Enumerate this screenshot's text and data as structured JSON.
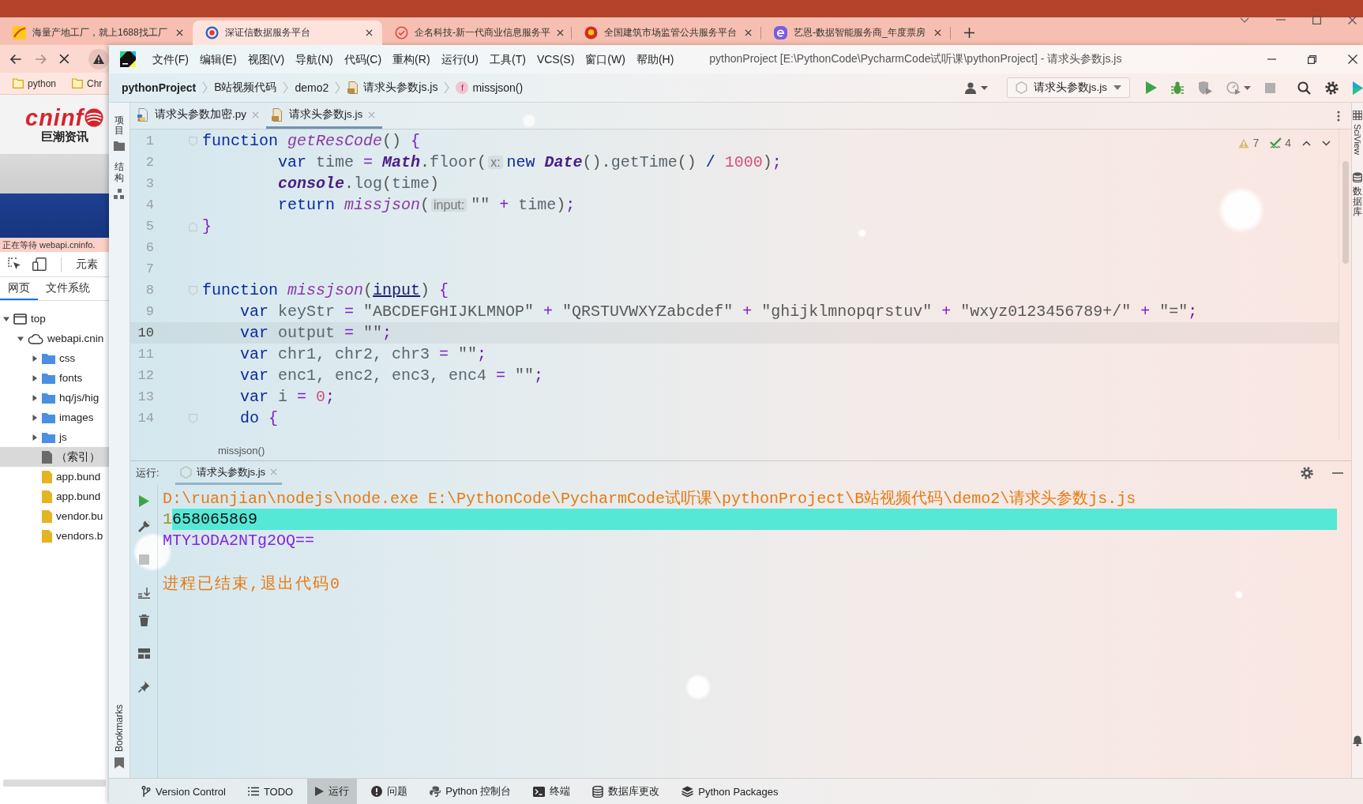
{
  "browser": {
    "tabs": [
      {
        "title": "海量产地工厂，就上1688找工厂",
        "selected": false
      },
      {
        "title": "深证信数据服务平台",
        "selected": true
      },
      {
        "title": "企名科技-新一代商业信息服务平",
        "selected": false
      },
      {
        "title": "全国建筑市场监管公共服务平台",
        "selected": false
      },
      {
        "title": "艺恩-数据智能服务商_年度票房",
        "selected": false
      }
    ],
    "bookmarks": [
      {
        "label": "python"
      },
      {
        "label": "Chr"
      }
    ],
    "page": {
      "logo": "cninf",
      "logo_subtitle": "巨潮资讯",
      "status": "正在等待 webapi.cninfo."
    },
    "devtools": {
      "panel": "元素",
      "tabs": [
        {
          "label": "网页",
          "selected": true
        },
        {
          "label": "文件系统",
          "selected": false
        }
      ],
      "tree": [
        {
          "label": "top",
          "kind": "frame",
          "expanded": true,
          "selected": false,
          "children": [
            {
              "label": "webapi.cnin",
              "kind": "origin",
              "expanded": true,
              "selected": false,
              "children": [
                {
                  "label": "css",
                  "kind": "folder",
                  "expanded": false,
                  "selected": false
                },
                {
                  "label": "fonts",
                  "kind": "folder",
                  "expanded": false,
                  "selected": false
                },
                {
                  "label": "hq/js/hig",
                  "kind": "folder",
                  "expanded": false,
                  "selected": false
                },
                {
                  "label": "images",
                  "kind": "folder",
                  "expanded": false,
                  "selected": false
                },
                {
                  "label": "js",
                  "kind": "folder",
                  "expanded": false,
                  "selected": false
                },
                {
                  "label": "（索引）",
                  "kind": "document",
                  "selected": true
                },
                {
                  "label": "app.bund",
                  "kind": "script",
                  "selected": false
                },
                {
                  "label": "app.bund",
                  "kind": "script",
                  "selected": false
                },
                {
                  "label": "vendor.bu",
                  "kind": "script",
                  "selected": false
                },
                {
                  "label": "vendors.b",
                  "kind": "script",
                  "selected": false
                }
              ]
            }
          ]
        }
      ]
    }
  },
  "ide": {
    "menu": [
      "文件(F)",
      "编辑(E)",
      "视图(V)",
      "导航(N)",
      "代码(C)",
      "重构(R)",
      "运行(U)",
      "工具(T)",
      "VCS(S)",
      "窗口(W)",
      "帮助(H)"
    ],
    "title": "pythonProject [E:\\PythonCode\\PycharmCode试听课\\pythonProject] - 请求头参数js.js",
    "breadcrumbs": [
      {
        "label": "pythonProject",
        "kind": "project"
      },
      {
        "label": "B站视频代码",
        "kind": "folder"
      },
      {
        "label": "demo2",
        "kind": "folder"
      },
      {
        "label": "请求头参数js.js",
        "kind": "file"
      },
      {
        "label": "missjson()",
        "kind": "function",
        "badge": "f"
      }
    ],
    "run_config": "请求头参数js.js",
    "left_tools": [
      {
        "label": "项目",
        "kind": "project"
      },
      {
        "label": "结构",
        "kind": "structure"
      }
    ],
    "left_tools_bottom": [
      {
        "label": "Bookmarks",
        "kind": "bookmarks"
      }
    ],
    "right_tools": [
      {
        "label": "SciView",
        "kind": "sciview"
      },
      {
        "label": "数据库",
        "kind": "database"
      }
    ],
    "editor_tabs": [
      {
        "label": "请求头参数加密.py",
        "kind": "python",
        "selected": false
      },
      {
        "label": "请求头参数js.js",
        "kind": "js",
        "selected": true
      }
    ],
    "inspections": {
      "warnings": "7",
      "checks": "4"
    },
    "code_lines": [
      {
        "number": "1",
        "kind": "open",
        "current": false,
        "tokens": [
          {
            "kind": "kw",
            "text": "function "
          },
          {
            "kind": "fn",
            "text": "getResCode"
          },
          {
            "kind": "punct",
            "text": "() "
          },
          {
            "kind": "brace",
            "text": "{"
          }
        ]
      },
      {
        "number": "2",
        "kind": "plain",
        "current": false,
        "tokens": [
          {
            "kind": "kw",
            "text": "        var "
          },
          {
            "kind": "id",
            "text": "time "
          },
          {
            "kind": "op",
            "text": "= "
          },
          {
            "kind": "cls",
            "text": "Math"
          },
          {
            "kind": "punct",
            "text": "."
          },
          {
            "kind": "method",
            "text": "floor"
          },
          {
            "kind": "punct",
            "text": "("
          },
          {
            "kind": "hint",
            "text": "x:"
          },
          {
            "kind": "kw",
            "text": "new "
          },
          {
            "kind": "cls",
            "text": "Date"
          },
          {
            "kind": "punct",
            "text": "()."
          },
          {
            "kind": "method",
            "text": "getTime"
          },
          {
            "kind": "punct",
            "text": "() "
          },
          {
            "kind": "kw",
            "text": "/ "
          },
          {
            "kind": "num",
            "text": "1000"
          },
          {
            "kind": "punct",
            "text": ")"
          },
          {
            "kind": "semi",
            "text": ";"
          }
        ]
      },
      {
        "number": "3",
        "kind": "plain",
        "current": false,
        "tokens": [
          {
            "kind": "cls",
            "text": "        console"
          },
          {
            "kind": "punct",
            "text": "."
          },
          {
            "kind": "method",
            "text": "log"
          },
          {
            "kind": "punct",
            "text": "("
          },
          {
            "kind": "id",
            "text": "time"
          },
          {
            "kind": "punct",
            "text": ")"
          }
        ]
      },
      {
        "number": "4",
        "kind": "plain",
        "current": false,
        "tokens": [
          {
            "kind": "kw",
            "text": "        return "
          },
          {
            "kind": "fn",
            "text": "missjson"
          },
          {
            "kind": "punct",
            "text": "("
          },
          {
            "kind": "hint",
            "text": "input:"
          },
          {
            "kind": "str",
            "text": "\"\" "
          },
          {
            "kind": "op",
            "text": "+ "
          },
          {
            "kind": "id",
            "text": "time"
          },
          {
            "kind": "punct",
            "text": ")"
          },
          {
            "kind": "semi",
            "text": ";"
          }
        ]
      },
      {
        "number": "5",
        "kind": "close",
        "current": false,
        "tokens": [
          {
            "kind": "brace",
            "text": "}"
          }
        ]
      },
      {
        "number": "6",
        "kind": "plain",
        "current": false
      },
      {
        "number": "7",
        "kind": "plain",
        "current": false
      },
      {
        "number": "8",
        "kind": "open",
        "current": false,
        "tokens": [
          {
            "kind": "kw",
            "text": "function "
          },
          {
            "kind": "fn",
            "text": "missjson"
          },
          {
            "kind": "punct",
            "text": "("
          },
          {
            "kind": "param",
            "text": "input"
          },
          {
            "kind": "punct",
            "text": ") "
          },
          {
            "kind": "brace",
            "text": "{"
          }
        ]
      },
      {
        "number": "9",
        "kind": "plain",
        "current": false,
        "tokens": [
          {
            "kind": "kw",
            "text": "    var "
          },
          {
            "kind": "id",
            "text": "keyStr "
          },
          {
            "kind": "op",
            "text": "= "
          },
          {
            "kind": "str",
            "text": "\"ABCDEFGHIJKLMNOP\" "
          },
          {
            "kind": "op",
            "text": "+ "
          },
          {
            "kind": "str",
            "text": "\"QRSTUVWXYZabcdef\" "
          },
          {
            "kind": "op",
            "text": "+ "
          },
          {
            "kind": "str",
            "text": "\"ghijklmnopqrstuv\" "
          },
          {
            "kind": "op",
            "text": "+ "
          },
          {
            "kind": "str",
            "text": "\"wxyz0123456789+/\" "
          },
          {
            "kind": "op",
            "text": "+ "
          },
          {
            "kind": "str",
            "text": "\"=\""
          },
          {
            "kind": "semi",
            "text": ";"
          }
        ]
      },
      {
        "number": "10",
        "kind": "plain",
        "current": true,
        "tokens": [
          {
            "kind": "kw",
            "text": "    var "
          },
          {
            "kind": "id",
            "text": "output "
          },
          {
            "kind": "op",
            "text": "= "
          },
          {
            "kind": "str",
            "text": "\"\""
          },
          {
            "kind": "semi",
            "text": ";"
          }
        ]
      },
      {
        "number": "11",
        "kind": "plain",
        "current": false,
        "tokens": [
          {
            "kind": "kw",
            "text": "    var "
          },
          {
            "kind": "id",
            "text": "chr1, chr2, chr3 "
          },
          {
            "kind": "op",
            "text": "= "
          },
          {
            "kind": "str",
            "text": "\"\""
          },
          {
            "kind": "semi",
            "text": ";"
          }
        ]
      },
      {
        "number": "12",
        "kind": "plain",
        "current": false,
        "tokens": [
          {
            "kind": "kw",
            "text": "    var "
          },
          {
            "kind": "id",
            "text": "enc1, enc2, enc3, enc4 "
          },
          {
            "kind": "op",
            "text": "= "
          },
          {
            "kind": "str",
            "text": "\"\""
          },
          {
            "kind": "semi",
            "text": ";"
          }
        ]
      },
      {
        "number": "13",
        "kind": "plain",
        "current": false,
        "tokens": [
          {
            "kind": "kw",
            "text": "    var "
          },
          {
            "kind": "id",
            "text": "i "
          },
          {
            "kind": "op",
            "text": "= "
          },
          {
            "kind": "num",
            "text": "0"
          },
          {
            "kind": "semi",
            "text": ";"
          }
        ]
      },
      {
        "number": "14",
        "kind": "open",
        "current": false,
        "tokens": [
          {
            "kind": "kw",
            "text": "    do "
          },
          {
            "kind": "brace",
            "text": "{"
          }
        ]
      }
    ],
    "editor_breadcrumb": "missjson()",
    "run_panel": {
      "label": "运行:",
      "tabs": [
        {
          "label": "请求头参数js.js",
          "selected": true
        }
      ],
      "output": [
        {
          "kind": "command",
          "parts": [
            {
              "text": "D:\\ruanjian\\nodejs\\node.exe E:\\PythonCode\\PycharmCode试听课\\pythonProject\\B站视频代码\\demo2\\请求头参数js.js",
              "selected": false
            }
          ]
        },
        {
          "kind": "stdout",
          "parts": [
            {
              "text": "1",
              "selected": false
            },
            {
              "text": "658065869",
              "selected": true
            }
          ]
        },
        {
          "kind": "value",
          "parts": [
            {
              "text": "MTY1ODA2NTg2OQ==",
              "selected": false
            }
          ]
        },
        {
          "kind": "exit",
          "parts": [
            {
              "text": "进程已结束,退出代码0",
              "selected": false
            }
          ]
        }
      ]
    },
    "tool_windows": [
      {
        "label": "Version Control",
        "kind": "vcs",
        "selected": false
      },
      {
        "label": "TODO",
        "kind": "todo",
        "selected": false
      },
      {
        "label": "运行",
        "kind": "run",
        "selected": true
      },
      {
        "label": "问题",
        "kind": "problems",
        "selected": false
      },
      {
        "label": "Python 控制台",
        "kind": "console",
        "selected": false
      },
      {
        "label": "终端",
        "kind": "terminal",
        "selected": false
      },
      {
        "label": "数据库更改",
        "kind": "database",
        "selected": false
      },
      {
        "label": "Python Packages",
        "kind": "packages",
        "selected": false
      }
    ]
  }
}
